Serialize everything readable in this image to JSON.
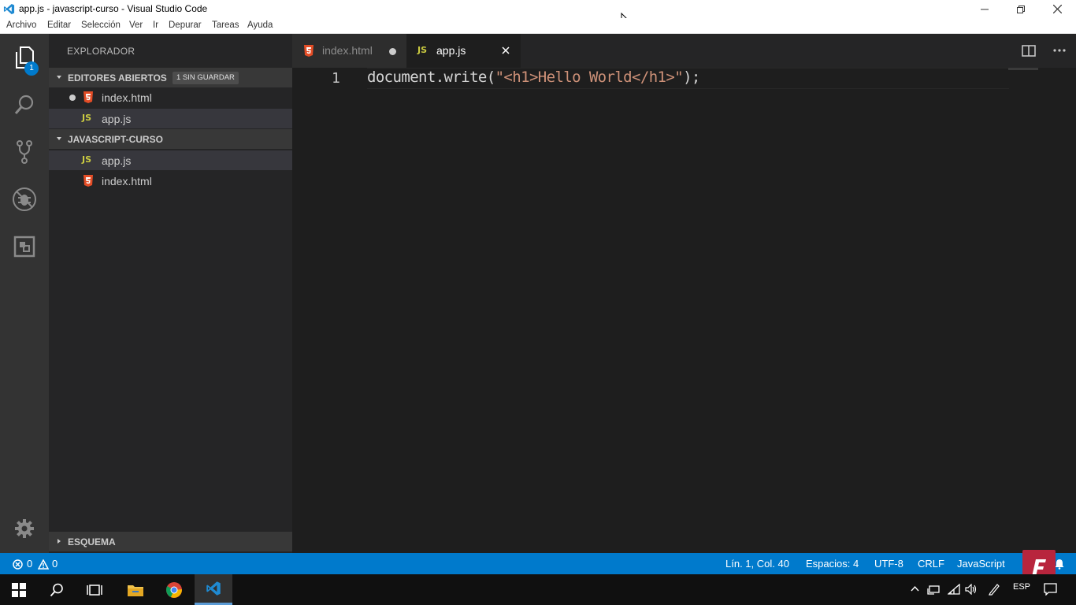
{
  "window": {
    "title": "app.js - javascript-curso - Visual Studio Code",
    "controls": [
      "minimize",
      "restore",
      "close"
    ]
  },
  "menu": [
    "Archivo",
    "Editar",
    "Selección",
    "Ver",
    "Ir",
    "Depurar",
    "Tareas",
    "Ayuda"
  ],
  "activity_bar": {
    "explorer_badge": "1",
    "items": [
      "files-icon",
      "search-icon",
      "source-control-icon",
      "debug-icon",
      "extensions-icon"
    ],
    "bottom": "gear-icon"
  },
  "sidebar": {
    "title": "EXPLORADOR",
    "open_editors": {
      "header": "EDITORES ABIERTOS",
      "badge": "1 SIN GUARDAR",
      "files": [
        {
          "name": "index.html",
          "type": "html",
          "unsaved": true
        },
        {
          "name": "app.js",
          "type": "js",
          "selected": true
        }
      ]
    },
    "folder": {
      "header": "JAVASCRIPT-CURSO",
      "files": [
        {
          "name": "app.js",
          "type": "js",
          "selected": true
        },
        {
          "name": "index.html",
          "type": "html"
        }
      ]
    },
    "outline": {
      "header": "ESQUEMA"
    }
  },
  "tabs": [
    {
      "label": "index.html",
      "type": "html",
      "dirty": true,
      "active": false
    },
    {
      "label": "app.js",
      "type": "js",
      "dirty": false,
      "active": true
    }
  ],
  "editor": {
    "lines": [
      {
        "number": "1",
        "ident": "document.write",
        "open": "(",
        "string": "\"<h1>Hello World</h1>\"",
        "close": ");"
      }
    ]
  },
  "status": {
    "errors": "0",
    "warnings": "0",
    "position": "Lín. 1, Col. 40",
    "spaces": "Espacios: 4",
    "encoding": "UTF-8",
    "eol": "CRLF",
    "language": "JavaScript"
  },
  "taskbar": {
    "language": "ESP"
  },
  "colors": {
    "accent": "#007acc",
    "html_icon": "#e44d26",
    "js_icon": "#cbcb41",
    "string": "#ce9178"
  }
}
